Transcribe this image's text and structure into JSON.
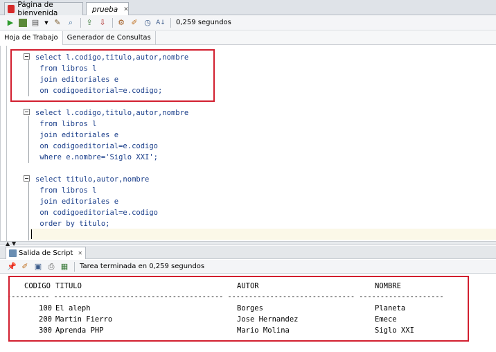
{
  "doc_tabs": [
    {
      "label": "Página de bienvenida",
      "icon": "oracle-icon"
    },
    {
      "label": "prueba",
      "icon": "sql-worksheet-icon"
    }
  ],
  "toolbar": {
    "icons": [
      "run-statement-icon",
      "run-script-icon",
      "autotrace-icon",
      "explain-plan-icon",
      "sql-tuning-icon",
      "commit-icon",
      "rollback-icon",
      "unshared-sql-icon",
      "clear-icon",
      "history-icon",
      "format-icon"
    ],
    "elapsed": "0,259 segundos"
  },
  "sub_tabs": [
    "Hoja de Trabajo",
    "Generador de Consultas"
  ],
  "editor": {
    "lines": [
      "select l.codigo,titulo,autor,nombre",
      " from libros l",
      " join editoriales e",
      " on codigoeditorial=e.codigo;",
      "select l.codigo,titulo,autor,nombre",
      " from libros l",
      " join editoriales e",
      " on codigoeditorial=e.codigo",
      " where e.nombre='Siglo XXI';",
      "select titulo,autor,nombre",
      " from libros l",
      " join editoriales e",
      " on codigoeditorial=e.codigo",
      " order by titulo;"
    ]
  },
  "output": {
    "tab_label": "Salida de Script",
    "status": "Tarea terminada en 0,259 segundos",
    "columns": [
      "CODIGO",
      "TITULO",
      "AUTOR",
      "NOMBRE"
    ],
    "separator": "---------- ---------------------------------------- ------------------------------ --------------------",
    "rows": [
      [
        "100",
        "El aleph",
        "Borges",
        "Planeta"
      ],
      [
        "200",
        "Martin Fierro",
        "Jose Hernandez",
        "Emece"
      ],
      [
        "300",
        "Aprenda PHP",
        "Mario Molina",
        "Siglo XXI"
      ]
    ]
  },
  "colors": {
    "highlight_box": "#d21f2f",
    "code_text": "#1a3e8a"
  }
}
